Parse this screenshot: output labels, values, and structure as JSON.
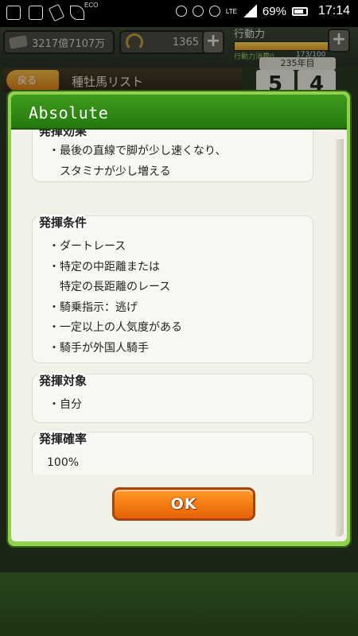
{
  "status_bar": {
    "eco_label": "ECO",
    "network": "LTE",
    "battery": "69%",
    "time": "17:14"
  },
  "top_bar": {
    "money": "3217億7107万",
    "horseshoes": "1365",
    "action_label": "行動力",
    "action_cost_label": "行動力消費0",
    "action_value": "173/100",
    "action_fill_fraction": 1.0
  },
  "background": {
    "back_label": "戻る",
    "screen_title": "種牡馬リスト",
    "year": "235年目",
    "month": "5",
    "week": "4"
  },
  "dialog": {
    "title": "Absolute",
    "sections": [
      {
        "heading": "発揮効果",
        "lines": [
          "・最後の直線で脚が少し速くなり、",
          "　スタミナが少し増える"
        ]
      },
      {
        "heading": "発揮条件",
        "lines": [
          "・ダートレース",
          "・特定の中距離または",
          "　特定の長距離のレース",
          "・騎乗指示：逃げ",
          "・一定以上の人気度がある",
          "・騎手が外国人騎手"
        ]
      },
      {
        "heading": "発揮対象",
        "lines": [
          "・自分"
        ]
      },
      {
        "heading": "発揮確率",
        "lines": [
          "100%"
        ]
      }
    ],
    "ok_label": "OK"
  }
}
